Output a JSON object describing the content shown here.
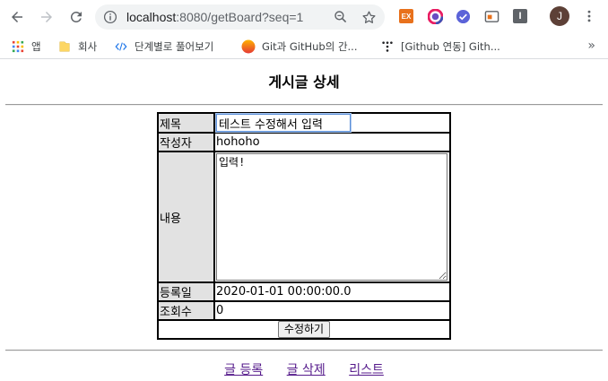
{
  "browser": {
    "url_host": "localhost",
    "url_path": ":8080/getBoard?seq=1",
    "profile_initial": "J",
    "extension_ex_label": "EX",
    "extension_i_label": "I",
    "bookmarks": [
      {
        "label": "앱",
        "icon": "apps-grid-icon"
      },
      {
        "label": "회사",
        "icon": "folder-icon"
      },
      {
        "label": "단계별로 풀어보기",
        "icon": "code-icon"
      },
      {
        "label": "Git과 GitHub의 간...",
        "icon": "orange-circle-icon"
      },
      {
        "label": "[Github 연동] Gith...",
        "icon": "dots-icon"
      }
    ],
    "bookmarks_more": "»"
  },
  "page": {
    "title": "게시글 상세",
    "fields": {
      "title_label": "제목",
      "title_value": "테스트 수정해서 입력",
      "writer_label": "작성자",
      "writer_value": "hohoho",
      "content_label": "내용",
      "content_value": "입력!",
      "regdate_label": "등록일",
      "regdate_value": "2020-01-01 00:00:00.0",
      "cnt_label": "조회수",
      "cnt_value": "0"
    },
    "submit_label": "수정하기",
    "links": {
      "insert": "글 등록",
      "delete": "글 삭제",
      "list": "리스트"
    }
  },
  "colors": {
    "link": "#551a8b",
    "label_bg": "#e2e2e2",
    "focus": "#5b8fd8"
  }
}
